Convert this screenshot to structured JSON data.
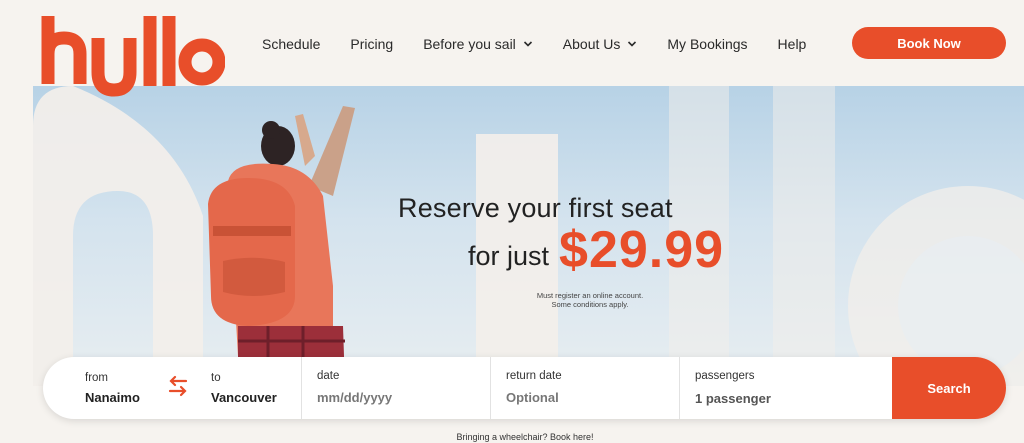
{
  "brand": {
    "logo_text": "hullo",
    "accent": "#e84e2a"
  },
  "nav": {
    "items": [
      {
        "label": "Schedule",
        "dropdown": false
      },
      {
        "label": "Pricing",
        "dropdown": false
      },
      {
        "label": "Before you sail",
        "dropdown": true
      },
      {
        "label": "About Us",
        "dropdown": true
      },
      {
        "label": "My Bookings",
        "dropdown": false
      },
      {
        "label": "Help",
        "dropdown": false
      }
    ],
    "cta": "Book Now"
  },
  "hero": {
    "line1": "Reserve your first seat",
    "line2": "for just",
    "price": "$29.99",
    "fine1": "Must register an online account.",
    "fine2": "Some conditions apply."
  },
  "booking": {
    "from_label": "from",
    "from_value": "Nanaimo",
    "to_label": "to",
    "to_value": "Vancouver",
    "date_label": "date",
    "date_placeholder": "mm/dd/yyyy",
    "return_label": "return date",
    "return_placeholder": "Optional",
    "passengers_label": "passengers",
    "passengers_value": "1 passenger",
    "search_label": "Search"
  },
  "footer_note": "Bringing a wheelchair? Book here!"
}
